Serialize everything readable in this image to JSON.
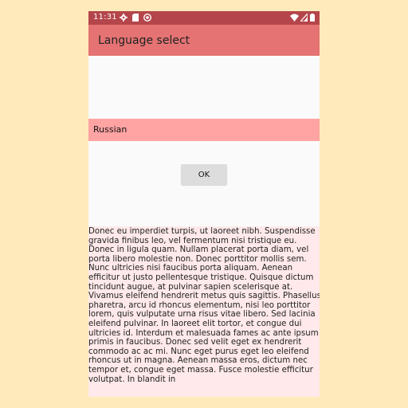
{
  "status_bar": {
    "time": "11:31",
    "left_icons": [
      "gear-icon",
      "sd-card-icon",
      "sync-icon"
    ],
    "right_icons": [
      "wifi-icon",
      "signal-icon",
      "battery-icon"
    ],
    "color": "#b4454b"
  },
  "app_bar": {
    "title": "Language select",
    "color": "#e57373"
  },
  "language_list": {
    "selected": "Russian",
    "selected_color": "#ffa3a3"
  },
  "ok_button": {
    "label": "OK"
  },
  "body_text": "Donec eu imperdiet turpis, ut laoreet nibh. Suspendisse gravida finibus leo, vel fermentum nisi tristique eu. Donec in ligula quam. Nullam placerat porta diam, vel porta libero molestie non. Donec porttitor mollis sem. Nunc ultricies nisi faucibus porta aliquam. Aenean efficitur ut justo pellentesque tristique. Quisque dictum tincidunt augue, at pulvinar sapien scelerisque at. Vivamus eleifend hendrerit metus quis sagittis. Phasellus pharetra, arcu id rhoncus elementum, nisi leo porttitor lorem, quis vulputate urna risus vitae libero. Sed lacinia eleifend pulvinar. In laoreet elit tortor, et congue dui ultricies id. Interdum et malesuada fames ac ante ipsum primis in faucibus. Donec sed velit eget ex hendrerit commodo ac ac mi. Nunc eget purus eget leo eleifend rhoncus ut in magna. Aenean massa eros, dictum nec tempor et, congue eget massa. Fusce molestie efficitur volutpat. In blandit in"
}
